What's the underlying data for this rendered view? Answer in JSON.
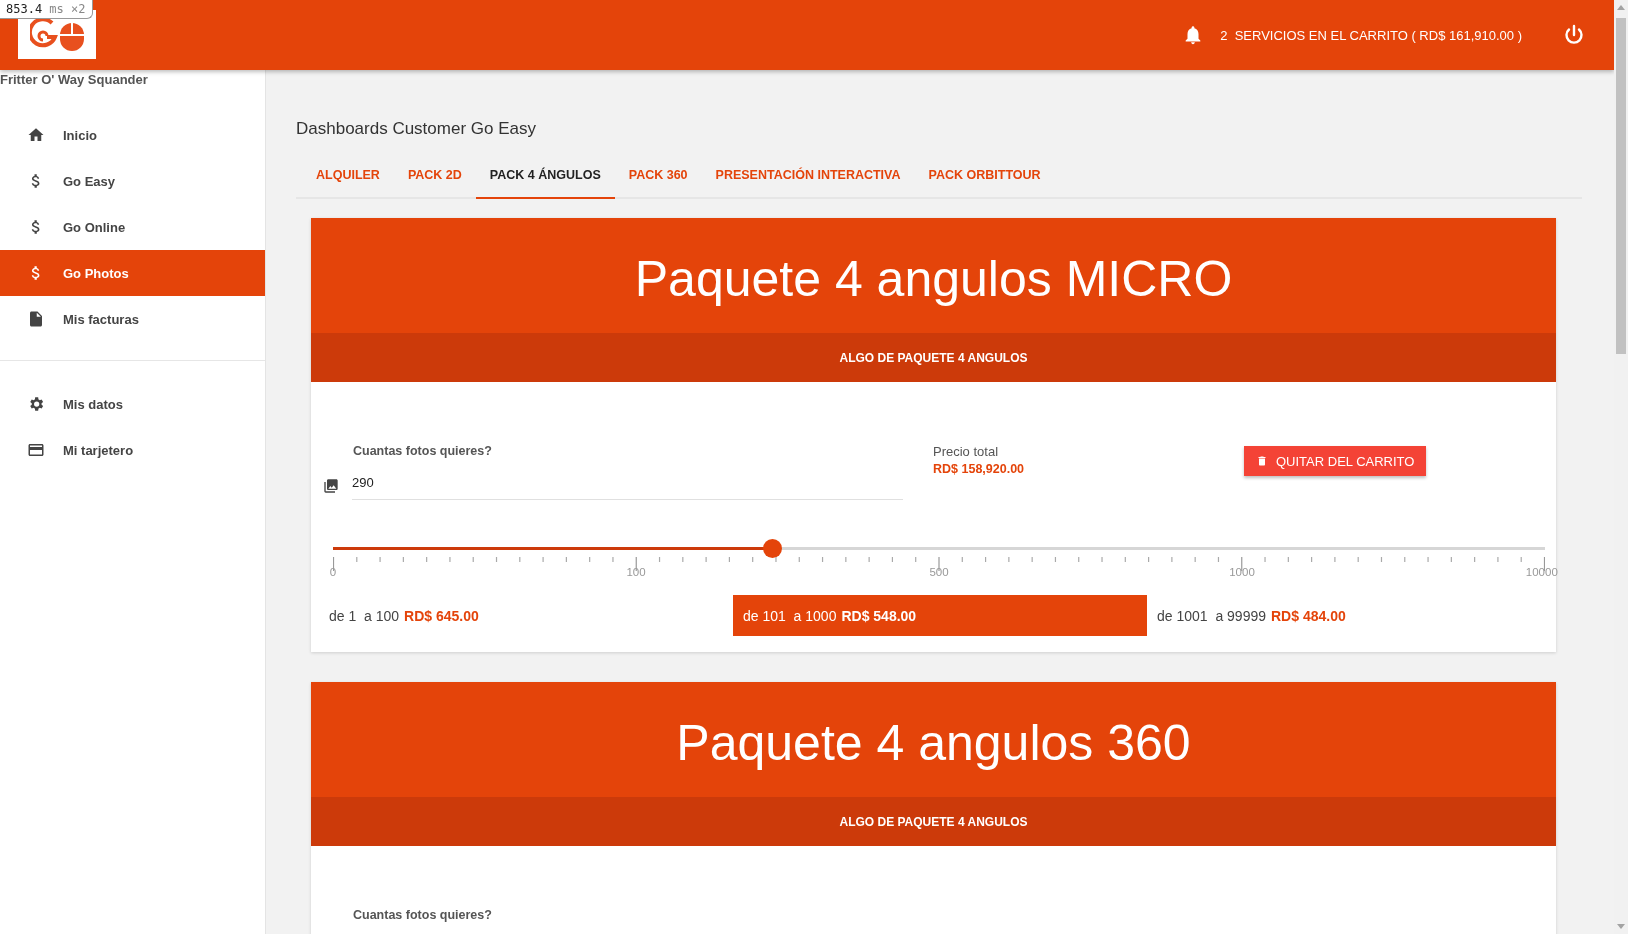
{
  "perf_overlay": {
    "value": "853.4",
    "unit": "ms",
    "multiplier": "×2"
  },
  "topbar": {
    "cart_summary": "2  SERVICIOS EN EL CARRITO ( RD$ 161,910.00 )"
  },
  "sidebar": {
    "user_name": "Fritter O' Way Squander",
    "items": [
      {
        "label": "Inicio",
        "selected": false
      },
      {
        "label": "Go Easy",
        "selected": false
      },
      {
        "label": "Go Online",
        "selected": false
      },
      {
        "label": "Go Photos",
        "selected": true
      },
      {
        "label": "Mis facturas",
        "selected": false
      }
    ],
    "secondary_items": [
      {
        "label": "Mis datos",
        "selected": false
      },
      {
        "label": "Mi tarjetero",
        "selected": false
      }
    ]
  },
  "page_title": "Dashboards Customer Go Easy",
  "tabs": [
    {
      "label": "ALQUILER",
      "selected": false
    },
    {
      "label": "PACK 2D",
      "selected": false
    },
    {
      "label": "PACK 4 ÁNGULOS",
      "selected": true
    },
    {
      "label": "PACK 360",
      "selected": false
    },
    {
      "label": "PRESENTACIÓN INTERACTIVA",
      "selected": false
    },
    {
      "label": "PACK ORBITTOUR",
      "selected": false
    }
  ],
  "packages": [
    {
      "title": "Paquete 4 angulos MICRO",
      "subtitle": "ALGO DE PAQUETE 4 ANGULOS",
      "quantity_label": "Cuantas fotos quieres?",
      "quantity": "290",
      "total_label": "Precio total",
      "total": "RD$ 158,920.00",
      "remove_button": "QUITAR DEL CARRITO",
      "slider": {
        "level": 0.362,
        "ticks": [
          "0",
          "100",
          "500",
          "1000",
          "10000"
        ]
      },
      "tiers": [
        {
          "range": "de 1  a 100",
          "price": "RD$ 645.00",
          "selected": false
        },
        {
          "range": "de 101  a 1000",
          "price": "RD$ 548.00",
          "selected": true
        },
        {
          "range": "de 1001  a 99999",
          "price": "RD$ 484.00",
          "selected": false
        }
      ]
    },
    {
      "title": "Paquete 4 angulos 360",
      "subtitle": "ALGO DE PAQUETE 4 ANGULOS",
      "quantity_label": "Cuantas fotos quieres?"
    }
  ]
}
